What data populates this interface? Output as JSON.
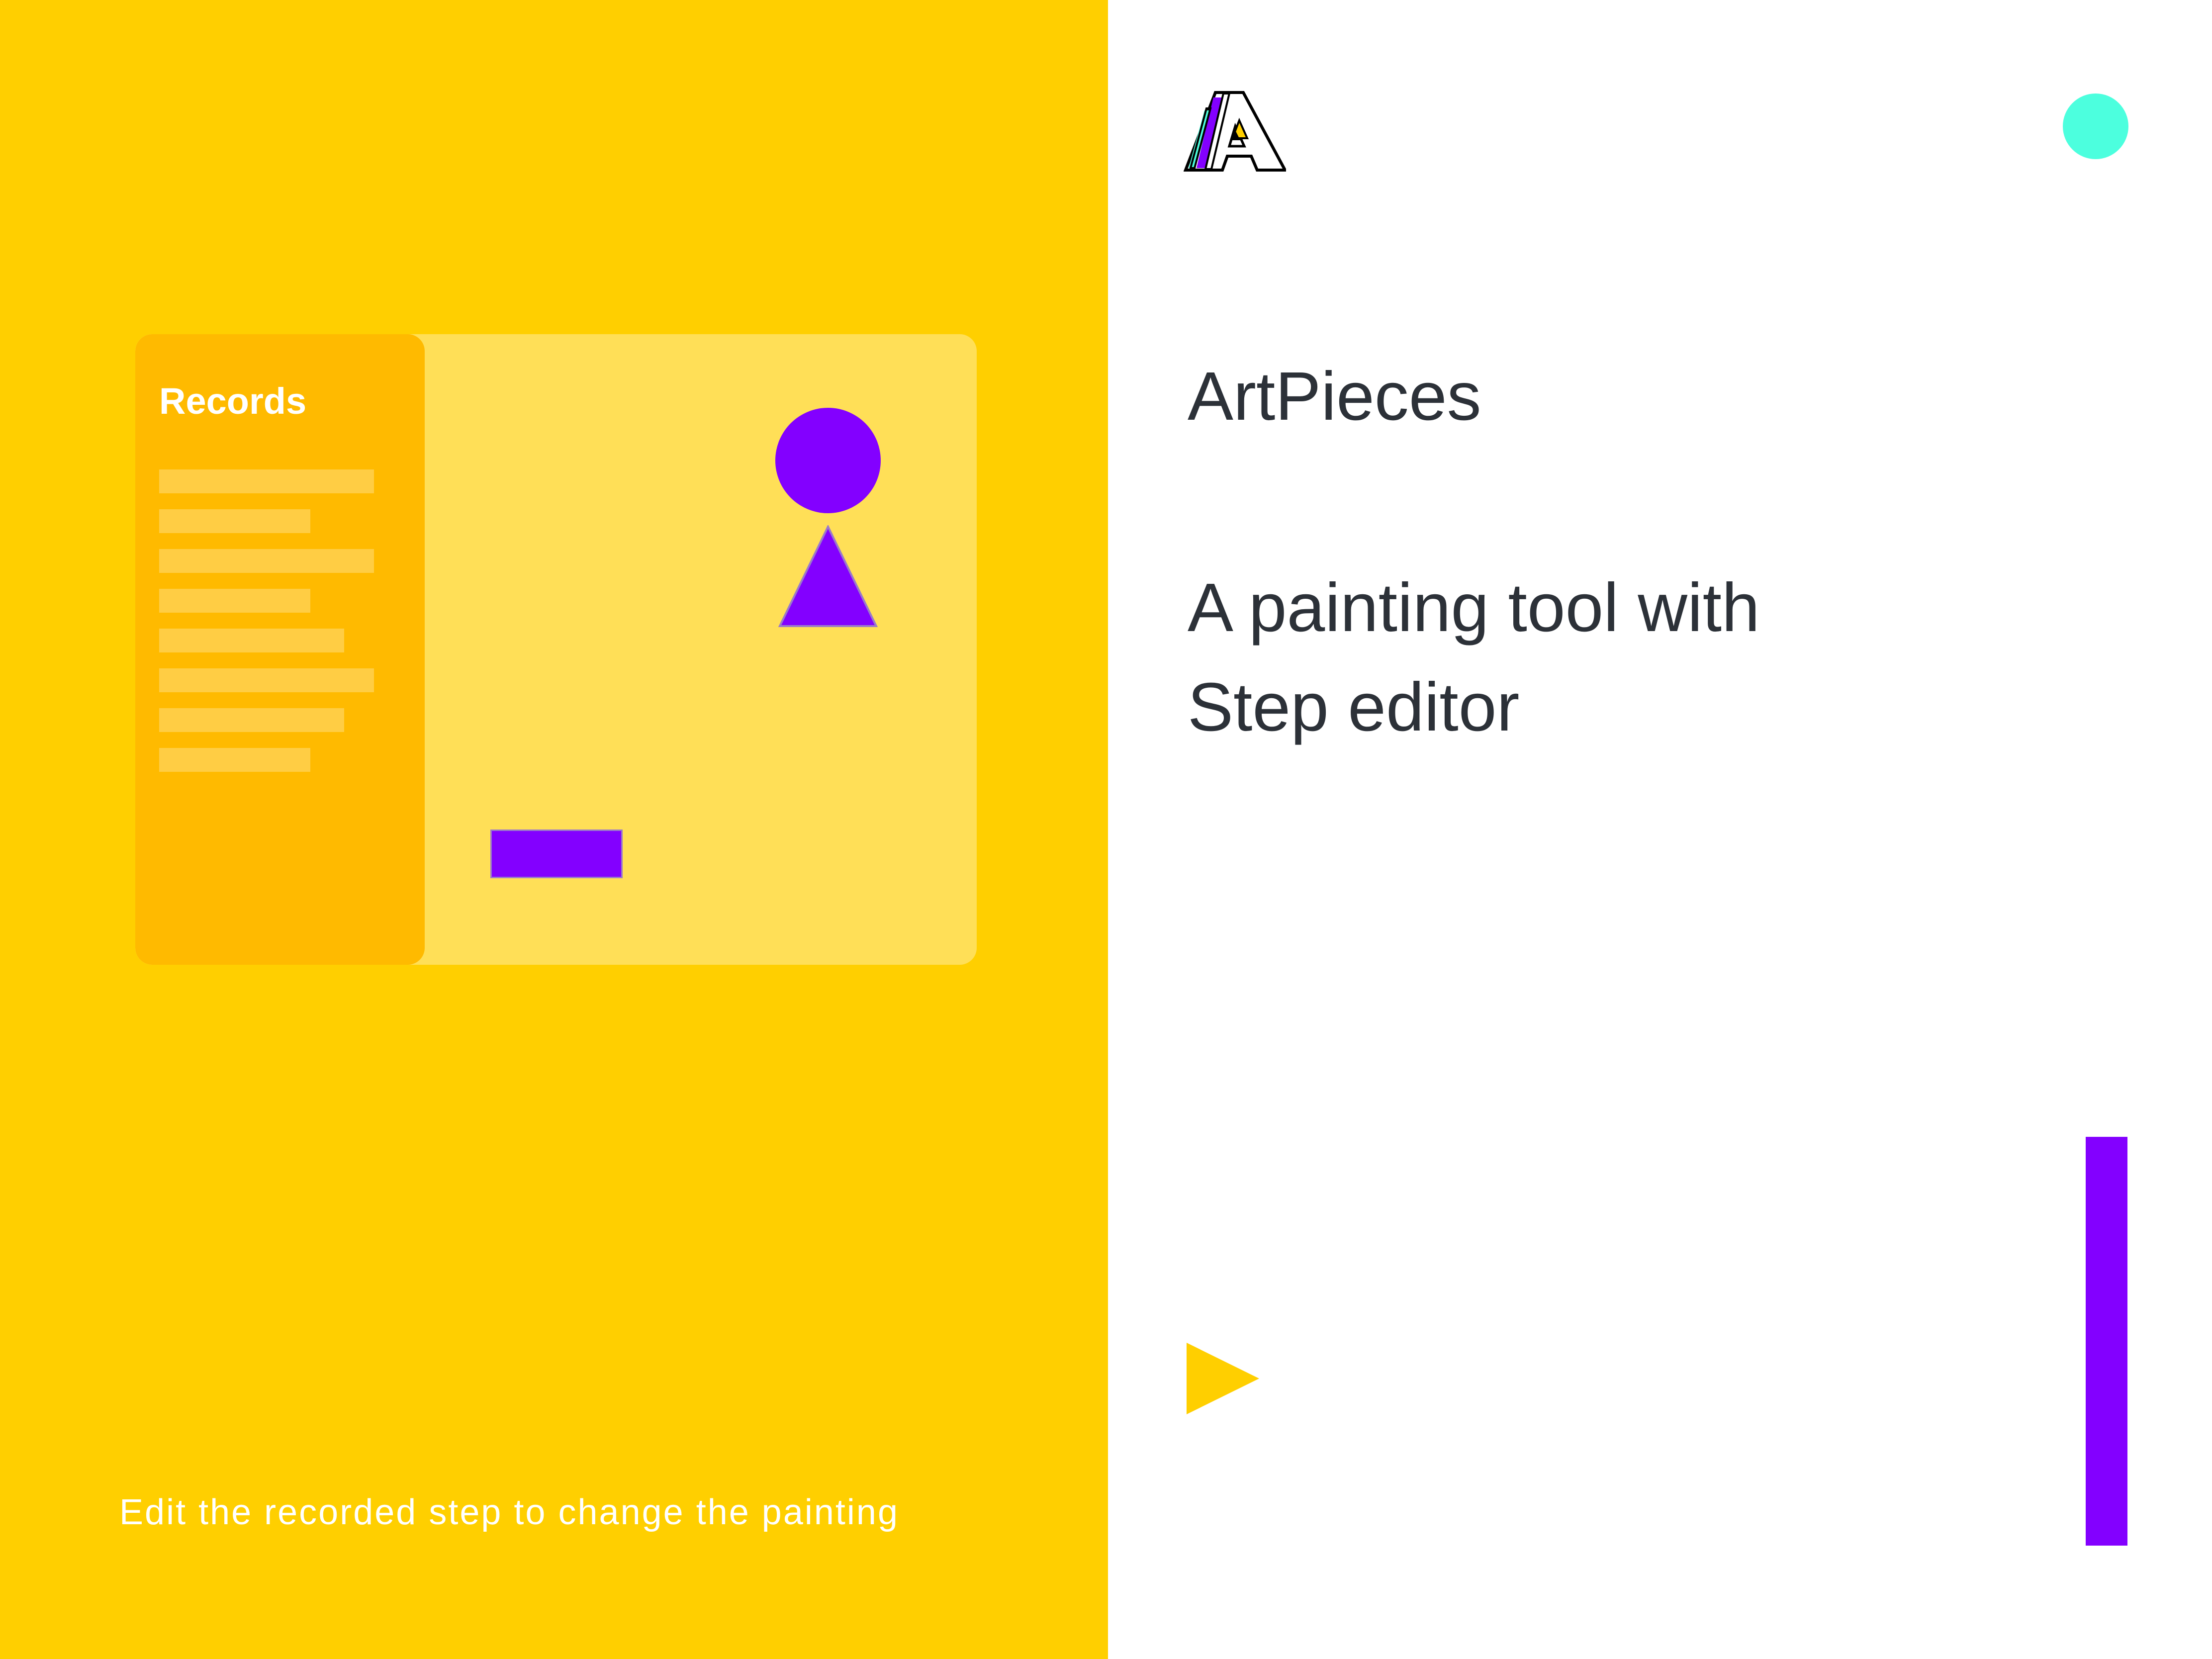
{
  "colors": {
    "left_panel_bg": "#FFCF00",
    "window_bg": "#FFDF57",
    "records_bg": "#FFBA00",
    "record_bar": "#FFCD44",
    "shape_fill": "#8300FF",
    "status_dot": "#4CFFDE",
    "text_dark": "#2C3138",
    "play_icon": "#FFCF00"
  },
  "left_panel": {
    "records_title": "Records",
    "record_count": 8,
    "shapes": [
      "circle",
      "triangle",
      "rectangle"
    ],
    "caption": "Edit the recorded step to change the painting"
  },
  "right_panel": {
    "logo_icon": "artpieces-logo-icon",
    "status_icon": "status-dot-icon",
    "app_title": "ArtPieces",
    "tagline_line1": "A painting tool with",
    "tagline_line2": "Step editor",
    "play_icon": "play-icon"
  }
}
